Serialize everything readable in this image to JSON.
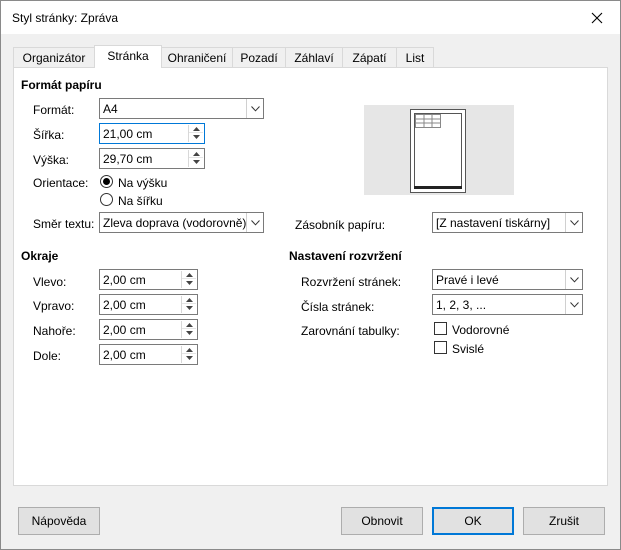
{
  "window": {
    "title": "Styl stránky: Zpráva"
  },
  "tabs": [
    "Organizátor",
    "Stránka",
    "Ohraničení",
    "Pozadí",
    "Záhlaví",
    "Zápatí",
    "List"
  ],
  "paper_format": {
    "heading": "Formát papíru",
    "format_label": "Formát:",
    "format_value": "A4",
    "width_label": "Šířka:",
    "width_value": "21,00 cm",
    "height_label": "Výška:",
    "height_value": "29,70 cm",
    "orientation_label": "Orientace:",
    "portrait_label": "Na výšku",
    "landscape_label": "Na šířku",
    "orientation_selected": "portrait",
    "text_direction_label": "Směr textu:",
    "text_direction_value": "Zleva doprava (vodorovně)",
    "paper_tray_label": "Zásobník papíru:",
    "paper_tray_value": "[Z nastavení tiskárny]"
  },
  "margins": {
    "heading": "Okraje",
    "left_label": "Vlevo:",
    "left_value": "2,00 cm",
    "right_label": "Vpravo:",
    "right_value": "2,00 cm",
    "top_label": "Nahoře:",
    "top_value": "2,00 cm",
    "bottom_label": "Dole:",
    "bottom_value": "2,00 cm"
  },
  "layout_settings": {
    "heading": "Nastavení rozvržení",
    "page_layout_label": "Rozvržení stránek:",
    "page_layout_value": "Pravé i levé",
    "page_numbers_label": "Čísla stránek:",
    "page_numbers_value": "1, 2, 3, ...",
    "table_alignment_label": "Zarovnání tabulky:",
    "horizontal_label": "Vodorovné",
    "vertical_label": "Svislé",
    "horizontal_checked": false,
    "vertical_checked": false
  },
  "buttons": {
    "help": "Nápověda",
    "reset": "Obnovit",
    "ok": "OK",
    "cancel": "Zrušit"
  },
  "colors": {
    "accent": "#0078d7",
    "dialog_bg": "#f0f0f0",
    "panel_bg": "#ffffff"
  }
}
